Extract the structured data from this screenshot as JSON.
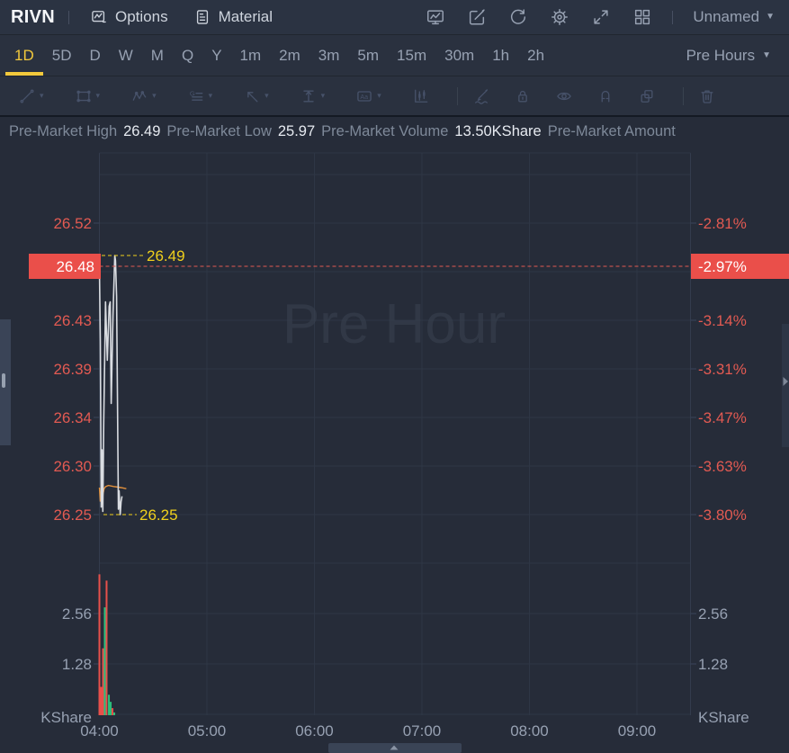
{
  "header": {
    "symbol": "RIVN",
    "tabs": [
      {
        "label": "Options",
        "icon": "chart-note-icon"
      },
      {
        "label": "Material",
        "icon": "document-icon"
      }
    ],
    "action_icons": [
      "screener-icon",
      "edit-icon",
      "refresh-icon",
      "settings-icon",
      "fullscreen-icon",
      "layout-icon"
    ],
    "workspace": {
      "label": "Unnamed",
      "caret": "▼"
    }
  },
  "timeframe_bar": {
    "items": [
      "1D",
      "5D",
      "D",
      "W",
      "M",
      "Q",
      "Y",
      "1m",
      "2m",
      "3m",
      "5m",
      "15m",
      "30m",
      "1h",
      "2h"
    ],
    "active_item": "1D",
    "session": {
      "label": "Pre Hours",
      "caret": "▼"
    }
  },
  "drawing_toolbar": {
    "tools": [
      {
        "icon": "trendline-icon",
        "dropdown": true
      },
      {
        "icon": "rectangle-icon",
        "dropdown": true
      },
      {
        "icon": "wave-icon",
        "dropdown": true
      },
      {
        "icon": "gann-icon",
        "dropdown": true
      },
      {
        "icon": "arrow-icon",
        "dropdown": true
      },
      {
        "icon": "measure-icon",
        "dropdown": true
      },
      {
        "icon": "text-icon",
        "dropdown": true
      },
      {
        "icon": "candlestick-icon",
        "dropdown": false,
        "bright": true
      },
      {
        "divider": true
      },
      {
        "icon": "brush-icon",
        "dropdown": false
      },
      {
        "icon": "lock-icon",
        "dropdown": false
      },
      {
        "icon": "eye-icon",
        "dropdown": false
      },
      {
        "icon": "magnet-icon",
        "dropdown": false
      },
      {
        "icon": "duplicate-icon",
        "dropdown": false
      },
      {
        "divider": true
      },
      {
        "icon": "trash-icon",
        "dropdown": false
      }
    ]
  },
  "stats_bar": {
    "items": [
      {
        "label": "Pre-Market High",
        "value": "26.49"
      },
      {
        "label": "Pre-Market Low",
        "value": "25.97"
      },
      {
        "label": "Pre-Market Volume",
        "value": "13.50KShare"
      },
      {
        "label": "Pre-Market Amount",
        "value": ""
      }
    ]
  },
  "chart_data": {
    "type": "line",
    "session_watermark": "Pre Hour",
    "price_axis": {
      "top_row_price": 26.52,
      "row_step": 0.045,
      "ticks": [
        "26.52",
        "",
        "26.43",
        "26.39",
        "26.34",
        "26.30",
        "26.25"
      ]
    },
    "percent_axis": {
      "ticks": [
        "-2.81%",
        "",
        "-3.14%",
        "-3.31%",
        "-3.47%",
        "-3.63%",
        "-3.80%"
      ]
    },
    "current": {
      "price": 26.48,
      "price_label": "26.48",
      "percent_label": "-2.97%"
    },
    "high_marker": {
      "label": "26.49",
      "price": 26.49
    },
    "low_marker": {
      "label": "26.25",
      "price": 26.25
    },
    "time_axis": {
      "labels": [
        "04:00",
        "05:00",
        "06:00",
        "07:00",
        "08:00",
        "09:00"
      ]
    },
    "price_series": [
      [
        0,
        26.48
      ],
      [
        0.5,
        26.41
      ],
      [
        1,
        26.257
      ],
      [
        1.4,
        26.31
      ],
      [
        1.9,
        26.253
      ],
      [
        2.4,
        26.335
      ],
      [
        3.4,
        26.447
      ],
      [
        4.4,
        26.393
      ],
      [
        5.4,
        26.443
      ],
      [
        6,
        26.447
      ],
      [
        6.6,
        26.353
      ],
      [
        7.6,
        26.435
      ],
      [
        8.6,
        26.49
      ],
      [
        9,
        26.485
      ],
      [
        9.6,
        26.452
      ],
      [
        10.6,
        26.255
      ],
      [
        11,
        26.272
      ],
      [
        11.6,
        26.25
      ],
      [
        12.1,
        26.262
      ],
      [
        12.6,
        26.267
      ]
    ],
    "avg_series": [
      [
        0,
        26.275
      ],
      [
        0.5,
        26.262
      ],
      [
        1,
        26.273
      ],
      [
        1.5,
        26.26
      ],
      [
        2,
        26.269
      ],
      [
        2.6,
        26.274
      ],
      [
        3.5,
        26.276
      ],
      [
        5,
        26.277
      ],
      [
        8,
        26.276
      ],
      [
        12,
        26.275
      ],
      [
        15,
        26.274
      ]
    ],
    "volume": {
      "unit_label": "KShare",
      "ticks": [
        "2.56",
        "1.28"
      ],
      "tick_step": 1.28,
      "bars": [
        [
          0,
          3.58,
          "down"
        ],
        [
          1,
          0.72,
          "down"
        ],
        [
          2,
          1.7,
          "down"
        ],
        [
          3,
          2.74,
          "up"
        ],
        [
          4,
          3.42,
          "down"
        ],
        [
          5.3,
          0.52,
          "up"
        ],
        [
          6.3,
          0.34,
          "up"
        ],
        [
          7.3,
          0.18,
          "down"
        ],
        [
          8.3,
          0.07,
          "up"
        ]
      ]
    }
  },
  "colors": {
    "down_red": "#e8504b",
    "up_green": "#2bc17c",
    "axis_red": "#e25a52",
    "tag_bg": "#ea4f4a",
    "marker_yellow": "#f0d01c",
    "active_tab_yellow": "#f3c93c",
    "price_line": "#d9dce1",
    "avg_line": "#e2913c",
    "grid": "#2e3645",
    "pane_border": "#333c4d",
    "axis_gray": "#97a1b2"
  }
}
